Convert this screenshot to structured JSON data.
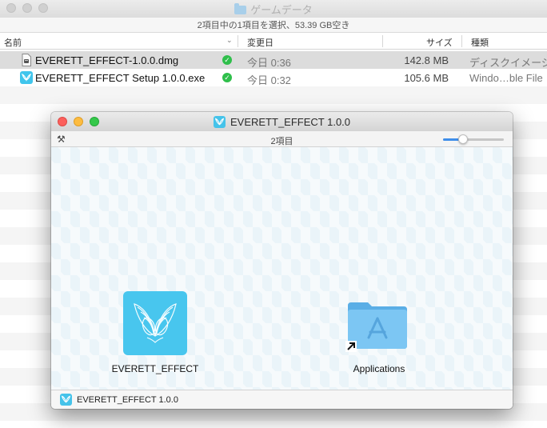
{
  "finder": {
    "title": "ゲームデータ",
    "status_text": "2項目中の1項目を選択、53.39 GB空き",
    "columns": {
      "name": "名前",
      "modified": "変更日",
      "size": "サイズ",
      "kind": "種類"
    },
    "files": [
      {
        "name": "EVERETT_EFFECT-1.0.0.dmg",
        "modified": "今日 0:36",
        "size": "142.8 MB",
        "kind": "ディスクイメージ",
        "icon": "dmg-file-icon",
        "selected": true
      },
      {
        "name": "EVERETT_EFFECT Setup 1.0.0.exe",
        "modified": "今日 0:32",
        "size": "105.6 MB",
        "kind": "Windo…ble File",
        "icon": "app-file-icon",
        "selected": false
      }
    ]
  },
  "dmg_window": {
    "title": "EVERETT_EFFECT 1.0.0",
    "item_count": "2項目",
    "icon_size_level": 0.3,
    "app_label": "EVERETT_EFFECT",
    "apps_label": "Applications",
    "volume_label": "EVERETT_EFFECT 1.0.0"
  },
  "colors": {
    "app_icon": "#48c6ee",
    "apps_folder": "#6bbdee",
    "sync_check": "#2fbf4b",
    "close": "#fc605c",
    "minimize": "#fdbc40",
    "maximize": "#34c84a"
  }
}
